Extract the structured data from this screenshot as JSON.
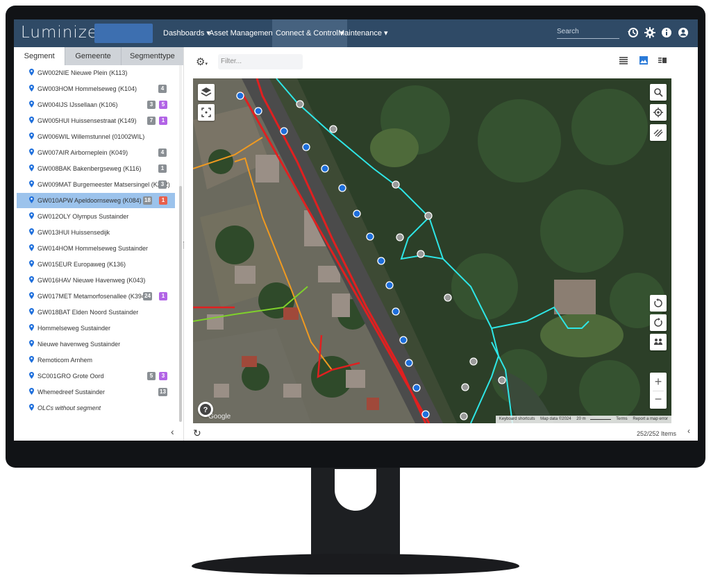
{
  "app": {
    "logo": "Luminizer"
  },
  "nav": {
    "menus": [
      {
        "label": "Dashboards ▾",
        "active": false
      },
      {
        "label": "Asset Management ▾",
        "active": false
      },
      {
        "label": "Connect & Control ▾",
        "active": true
      },
      {
        "label": "Maintenance ▾",
        "active": false
      }
    ],
    "search_placeholder": "Search",
    "icons": [
      "history-icon",
      "gear-icon",
      "info-icon",
      "user-icon"
    ]
  },
  "left_panel": {
    "tabs": [
      {
        "label": "Segment",
        "active": true
      },
      {
        "label": "Gemeente",
        "active": false
      },
      {
        "label": "Segmenttype",
        "active": false
      }
    ],
    "items": [
      {
        "label": "GW002NIE Nieuwe Plein (K113)",
        "badges": []
      },
      {
        "label": "GW003HOM Hommelseweg (K104)",
        "badges": [
          {
            "text": "4",
            "color": "gray"
          }
        ]
      },
      {
        "label": "GW004IJS IJssellaan (K106)",
        "badges": [
          {
            "text": "3",
            "color": "gray"
          },
          {
            "text": "5",
            "color": "purple"
          }
        ]
      },
      {
        "label": "GW005HUI Huissensestraat (K149)",
        "badges": [
          {
            "text": "7",
            "color": "gray"
          },
          {
            "text": "1",
            "color": "purple"
          }
        ]
      },
      {
        "label": "GW006WIL Willemstunnel (01002WIL)",
        "badges": []
      },
      {
        "label": "GW007AIR Airborneplein (K049)",
        "badges": [
          {
            "text": "4",
            "color": "gray"
          }
        ]
      },
      {
        "label": "GW008BAK Bakenbergseweg (K116)",
        "badges": [
          {
            "text": "1",
            "color": "gray"
          }
        ]
      },
      {
        "label": "GW009MAT Burgemeester Matsersingel (K292)",
        "badges": [
          {
            "text": "3",
            "color": "gray"
          }
        ]
      },
      {
        "label": "GW010APW Apeldoornseweg (K084)",
        "badges": [
          {
            "text": "18",
            "color": "gray"
          },
          {
            "text": "1",
            "color": "red"
          }
        ],
        "selected": true
      },
      {
        "label": "GW012OLY Olympus Sustainder",
        "badges": []
      },
      {
        "label": "GW013HUI Huissensedijk",
        "badges": []
      },
      {
        "label": "GW014HOM Hommelseweg Sustainder",
        "badges": []
      },
      {
        "label": "GW015EUR Europaweg (K136)",
        "badges": []
      },
      {
        "label": "GW016HAV Nieuwe Havenweg (K043)",
        "badges": []
      },
      {
        "label": "GW017MET Metamorfosenallee (K394)",
        "badges": [
          {
            "text": "24",
            "color": "gray"
          },
          {
            "text": "1",
            "color": "purple"
          }
        ]
      },
      {
        "label": "GW018BAT Elden Noord Sustainder",
        "badges": []
      },
      {
        "label": "Hommelseweg Sustainder",
        "badges": []
      },
      {
        "label": "Nieuwe havenweg Sustainder",
        "badges": []
      },
      {
        "label": "Remoticom Arnhem",
        "badges": []
      },
      {
        "label": "SC001GRO Grote Oord",
        "badges": [
          {
            "text": "5",
            "color": "gray"
          },
          {
            "text": "3",
            "color": "purple"
          }
        ]
      },
      {
        "label": "Whemedreef Sustainder",
        "badges": [
          {
            "text": "13",
            "color": "gray"
          }
        ]
      },
      {
        "label": "OLCs without segment",
        "badges": [],
        "italic": true
      }
    ],
    "collapse_glyph": "‹"
  },
  "right_panel": {
    "filter_placeholder": "Filter...",
    "view_icons": [
      "list-view-icon",
      "map-view-icon",
      "split-view-icon"
    ],
    "map": {
      "attribution": [
        "Keyboard shortcuts",
        "Map data ©2024",
        "20 m",
        "Terms",
        "Report a map error"
      ],
      "google_text": "Google"
    },
    "count": "252/252 Items"
  },
  "colors": {
    "nav_bg": "#2f4a66",
    "accent": "#2a7ad8",
    "selected_row": "#9cc3ec",
    "badge_gray": "#8a8f94",
    "badge_purple": "#b264e6",
    "badge_red": "#e8604c",
    "route_red": "#e02020",
    "route_cyan": "#2ee6e6",
    "route_orange": "#f09a20",
    "route_green": "#7fd12b"
  }
}
